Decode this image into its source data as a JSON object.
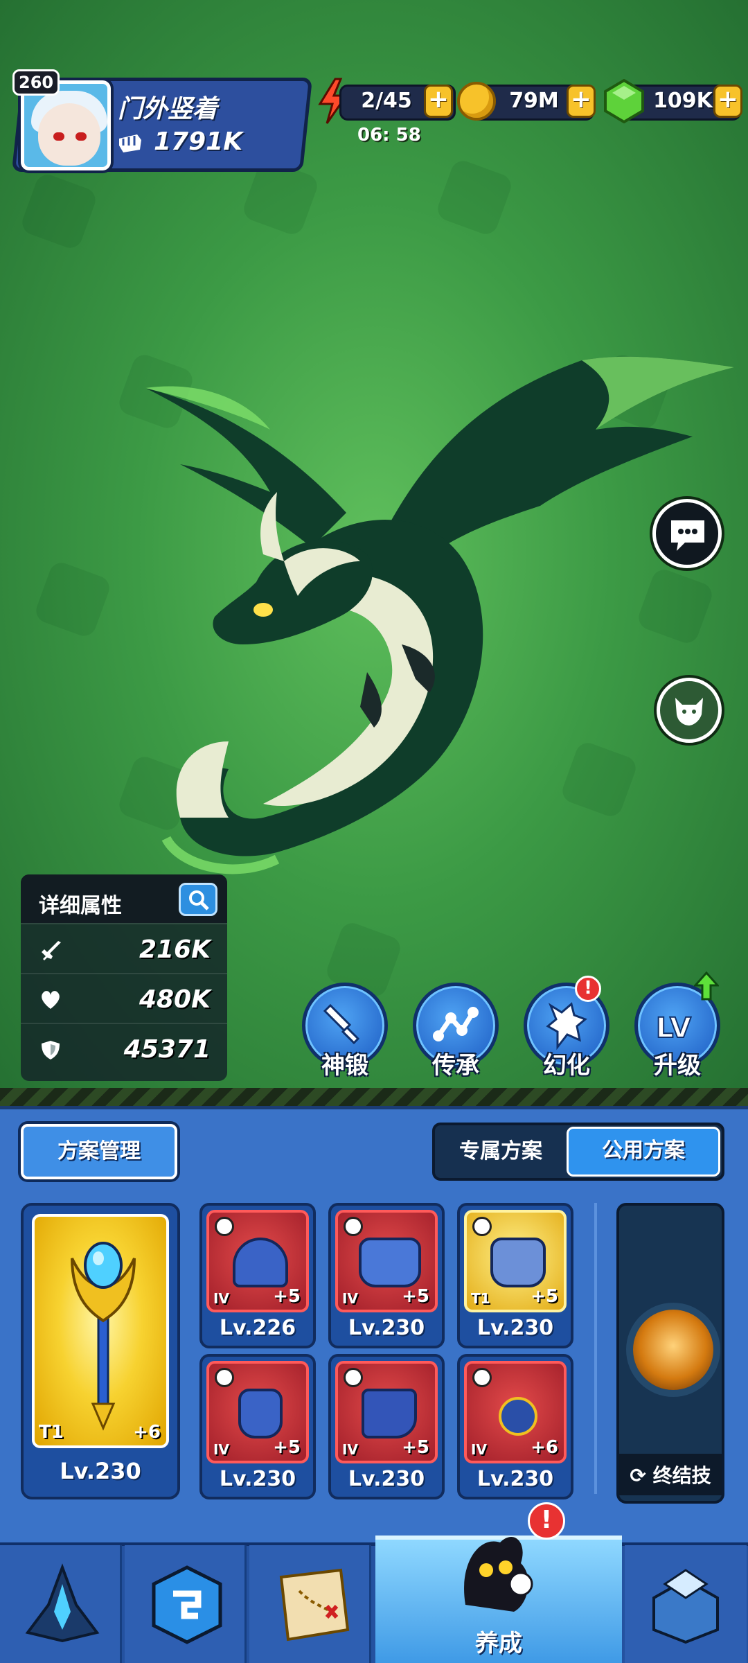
{
  "player": {
    "level": "260",
    "name": "门外竖着",
    "power": "1791K"
  },
  "resources": {
    "energy": "2/45",
    "energy_timer": "06: 58",
    "gold": "79M",
    "gems": "109K",
    "plus": "+"
  },
  "stats": {
    "title": "详细属性",
    "attack": "216K",
    "hp": "480K",
    "defense": "45371"
  },
  "actions": {
    "forge": "神锻",
    "inherit": "传承",
    "transform": "幻化",
    "upgrade": "升级",
    "alert": "!"
  },
  "plans": {
    "manage": "方案管理",
    "exclusive": "专属方案",
    "public": "公用方案"
  },
  "weapon": {
    "tier": "T1",
    "plus": "+6",
    "level": "Lv.230"
  },
  "equipment": [
    {
      "name": "helmet",
      "tier": "IV",
      "plus": "+5",
      "level": "Lv.226"
    },
    {
      "name": "armor",
      "tier": "IV",
      "plus": "+5",
      "level": "Lv.230"
    },
    {
      "name": "belt",
      "tier": "T1",
      "plus": "+5",
      "level": "Lv.230"
    },
    {
      "name": "gloves",
      "tier": "IV",
      "plus": "+5",
      "level": "Lv.230"
    },
    {
      "name": "boots",
      "tier": "IV",
      "plus": "+5",
      "level": "Lv.230"
    },
    {
      "name": "necklace",
      "tier": "IV",
      "plus": "+6",
      "level": "Lv.230"
    }
  ],
  "ultimate": {
    "label": "终结技"
  },
  "nav": {
    "active_label": "养成"
  },
  "colors": {
    "bg_green": "#3c9a45",
    "panel_blue": "#3a73c8",
    "accent_blue": "#2f93ee",
    "alert_red": "#e83232",
    "gold": "#f7c22a",
    "gem_green": "#5ed23a"
  }
}
